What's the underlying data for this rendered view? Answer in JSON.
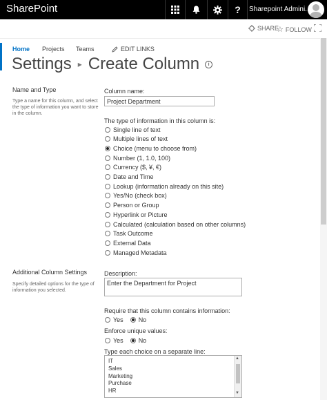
{
  "topbar": {
    "brand": "SharePoint",
    "user_name": "Sharepoint Admini..."
  },
  "suitebar": {
    "share_label": "SHARE",
    "follow_label": "FOLLOW"
  },
  "nav": {
    "items": [
      {
        "label": "Home",
        "active": true
      },
      {
        "label": "Projects",
        "active": false
      },
      {
        "label": "Teams",
        "active": false
      }
    ],
    "edit_links": "EDIT LINKS"
  },
  "page": {
    "breadcrumb_root": "Settings",
    "breadcrumb_current": "Create Column"
  },
  "name_type_section": {
    "title": "Name and Type",
    "description": "Type a name for this column, and select the type of information you want to store in the column.",
    "column_name_label": "Column name:",
    "column_name_value": "Project Department",
    "type_label": "The type of information in this column is:",
    "types": [
      {
        "label": "Single line of text",
        "selected": false
      },
      {
        "label": "Multiple lines of text",
        "selected": false
      },
      {
        "label": "Choice (menu to choose from)",
        "selected": true
      },
      {
        "label": "Number (1, 1.0, 100)",
        "selected": false
      },
      {
        "label": "Currency ($, ¥, €)",
        "selected": false
      },
      {
        "label": "Date and Time",
        "selected": false
      },
      {
        "label": "Lookup (information already on this site)",
        "selected": false
      },
      {
        "label": "Yes/No (check box)",
        "selected": false
      },
      {
        "label": "Person or Group",
        "selected": false
      },
      {
        "label": "Hyperlink or Picture",
        "selected": false
      },
      {
        "label": "Calculated (calculation based on other columns)",
        "selected": false
      },
      {
        "label": "Task Outcome",
        "selected": false
      },
      {
        "label": "External Data",
        "selected": false
      },
      {
        "label": "Managed Metadata",
        "selected": false
      }
    ]
  },
  "additional_section": {
    "title": "Additional Column Settings",
    "description": "Specify detailed options for the type of information you selected.",
    "description_label": "Description:",
    "description_value": "Enter the Department for Project",
    "require_label": "Require that this column contains information:",
    "require_yes": "Yes",
    "require_no": "No",
    "require_value": "No",
    "unique_label": "Enforce unique values:",
    "unique_yes": "Yes",
    "unique_no": "No",
    "unique_value": "No",
    "choices_label": "Type each choice on a separate line:",
    "choices": [
      "IT",
      "Sales",
      "Marketing",
      "Purchase",
      "HR"
    ]
  }
}
